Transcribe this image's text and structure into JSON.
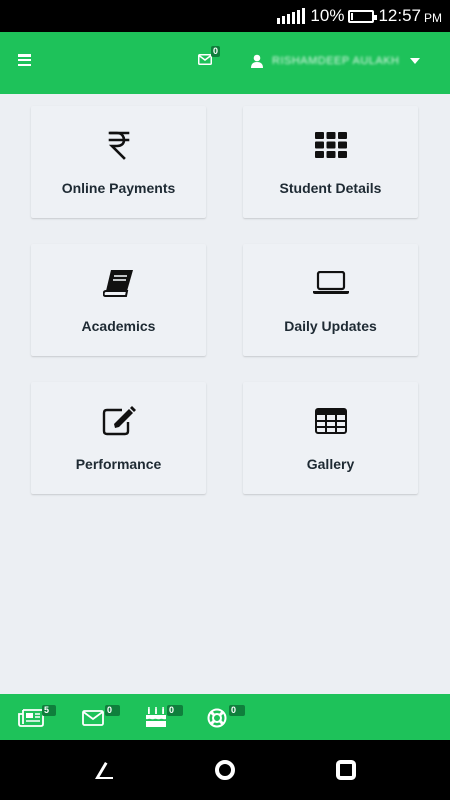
{
  "status_bar": {
    "battery_percent": "10%",
    "battery_level": 0.1,
    "time": "12:57",
    "ampm": "PM"
  },
  "header": {
    "menu_icon": "hamburger-menu-icon",
    "mail_badge": "0",
    "user_icon": "user-icon",
    "username": "RISHAMDEEP AULAKH"
  },
  "tiles": [
    {
      "label": "Online Payments",
      "icon": "rupee-icon"
    },
    {
      "label": "Student Details",
      "icon": "grid-icon"
    },
    {
      "label": "Academics",
      "icon": "book-icon"
    },
    {
      "label": "Daily Updates",
      "icon": "laptop-icon"
    },
    {
      "label": "Performance",
      "icon": "edit-icon"
    },
    {
      "label": "Gallery",
      "icon": "table-icon"
    }
  ],
  "bottom_bar": {
    "news": {
      "icon": "newspaper-icon",
      "badge": "5"
    },
    "mail": {
      "icon": "envelope-icon",
      "badge": "0"
    },
    "birthday": {
      "icon": "birthday-cake-icon",
      "badge": "0"
    },
    "support": {
      "icon": "lifebuoy-icon",
      "badge": "0"
    }
  },
  "colors": {
    "primary": "#1ec25a",
    "badge_bg": "#0f7f3c",
    "background": "#eceff3"
  }
}
